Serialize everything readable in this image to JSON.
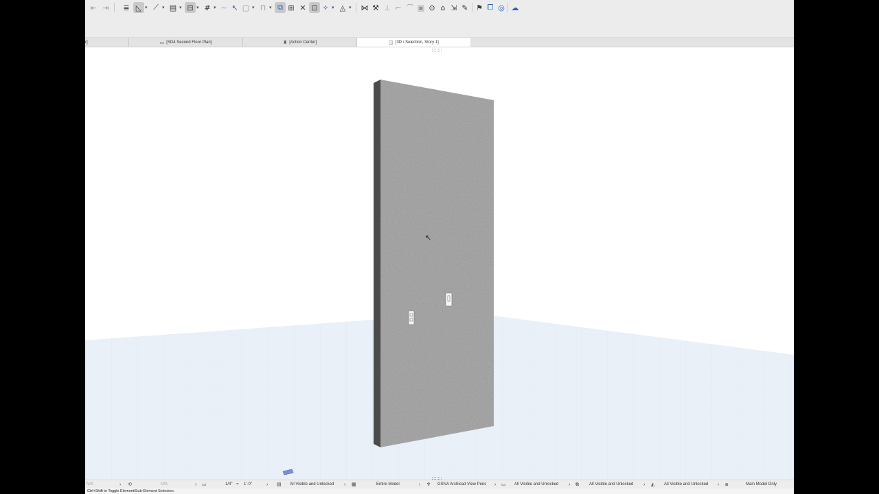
{
  "colors": {
    "wall_face": "#a9a9a9",
    "wall_side": "#4c4c4c",
    "ground": "#eaf0f8",
    "accent": "#2b62c4"
  },
  "toolbar": {
    "icons": [
      "arrow-icon",
      "arrow-icon",
      "structure-icon",
      "angle-icon",
      "angle-icon",
      "pan-icon",
      "pan-icon",
      "grid-icon",
      "line-icon",
      "rectangle-icon",
      "lock-icon",
      "pointer-icon",
      "select-icon",
      "table-icon",
      "transform-icon",
      "trim-icon",
      "sun-icon",
      "mirror-icon",
      "magic-wand-icon",
      "offset-icon",
      "rotate-icon",
      "adjust-icon",
      "roof-icon",
      "merge-icon",
      "edit-icon",
      "flag-icon",
      "marker-icon",
      "globe-icon",
      "cloud-icon"
    ]
  },
  "tabs": [
    {
      "label": "r]",
      "icon": ""
    },
    {
      "label": "[SD4 Second Floor Plan]",
      "icon": "floor-plan-icon"
    },
    {
      "label": "[Action Center]",
      "icon": "action-center-icon"
    },
    {
      "label": "[3D / Selection, Story 1]",
      "icon": "3d-window-icon"
    }
  ],
  "statusbar": {
    "undo_value": "N/A",
    "redo_value": "N/A",
    "scale": "1/4\"",
    "equals": "=",
    "scale_value": "1'-0\"",
    "layer_combo": "All Visible and Unlocked",
    "model_view": "Entire Model",
    "pen_set": "GSNA Archicad View Pens",
    "graphic_override": "All Visible and Unlocked",
    "partial_structure": "All Visible and Unlocked",
    "renovation_filter": "All Visible and Unlocked",
    "model_scope": "Main Model Only"
  },
  "hint": "Ctrl+Shift to Toggle Element/Sub-Element Selection."
}
